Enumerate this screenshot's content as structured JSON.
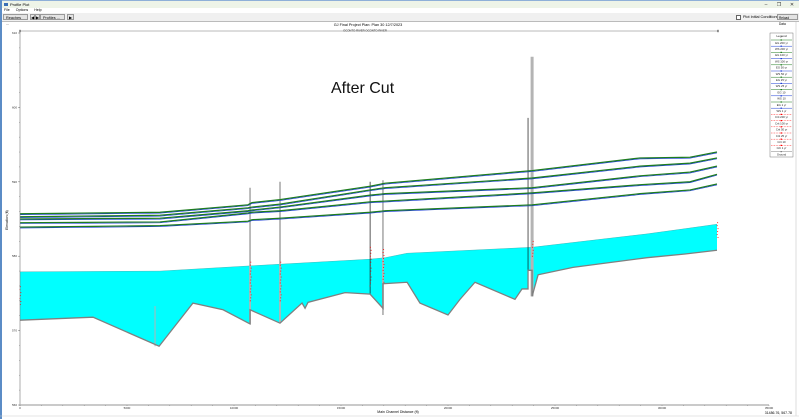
{
  "window": {
    "title": "Profile Plot",
    "minimize": "–",
    "maximize": "❐",
    "close": "✕"
  },
  "menu": [
    "File",
    "Options",
    "Help"
  ],
  "toolbar": {
    "reaches_label": "Reaches ...",
    "prev_label": "◀",
    "next_label": "▶",
    "profiles_label": "Profiles ...",
    "play_label": "▶",
    "plot_initial_label": "Plot Initial Conditions",
    "plot_initial_checked": false,
    "reload_label": "Reload Data"
  },
  "annotation": "After Cut",
  "status": {
    "coordinates": "31486.76, 567.78"
  },
  "colors": {
    "eg": "#1e7d1e",
    "ws": "#1a3cd6",
    "crit": "#ff0000",
    "ground": "#808080",
    "water_fill": "#00ffff",
    "structure": "#b4b4b4"
  },
  "chart_data": {
    "type": "line",
    "title": "GJ Final Project    Plan: Plan 30    12/7/2023",
    "subtitle": "OCONTO RIVER OCONTO RIVER",
    "xlabel": "Main Channel Distance (ft)",
    "ylabel": "Elevation (ft)",
    "xlim": [
      0,
      35000
    ],
    "ylim": [
      560,
      610
    ],
    "xticks": [
      0,
      5000,
      10000,
      15000,
      20000,
      25000,
      30000,
      35000
    ],
    "yticks": [
      560,
      570,
      580,
      590,
      600,
      610
    ],
    "legend": {
      "placement": "right",
      "title": "Legend",
      "entries": [
        "EG 200 yr",
        "WS 200 yr",
        "EG 100 yr",
        "WS 100 yr",
        "EG 50 yr",
        "WS 50 yr",
        "EG 25 yr",
        "WS 25 yr",
        "EG 10",
        "WS 10",
        "EG 1 yr",
        "WS 1 yr",
        "Crit 200 yr",
        "Crit 100 yr",
        "Crit 50 yr",
        "Crit 25 yr",
        "Crit 10",
        "Crit 1 yr",
        "Ground"
      ]
    },
    "profile_stations": [
      0,
      6540,
      10650,
      10840,
      12150,
      16360,
      17060,
      23930,
      28970,
      31310,
      32570
    ],
    "water_surface_lines": [
      [
        585.7,
        585.9,
        586.9,
        587.2,
        587.6,
        589.4,
        589.8,
        591.5,
        593.2,
        593.3,
        594.0
      ],
      [
        585.3,
        585.5,
        586.5,
        586.6,
        587.0,
        588.9,
        589.2,
        590.5,
        592.1,
        592.5,
        593.2
      ],
      [
        585.0,
        585.1,
        586.1,
        586.2,
        586.6,
        588.2,
        588.4,
        589.2,
        590.8,
        591.3,
        592.1
      ],
      [
        584.5,
        584.6,
        585.8,
        585.9,
        586.1,
        587.3,
        587.4,
        588.5,
        589.6,
        590.0,
        591.0
      ],
      [
        583.9,
        584.1,
        584.7,
        584.9,
        585.1,
        585.9,
        586.1,
        586.9,
        588.4,
        588.9,
        589.7
      ]
    ],
    "water_fill_top": {
      "x": [
        0,
        6540,
        10750,
        16360,
        17060,
        18090,
        23930,
        29300,
        31080,
        32570
      ],
      "y": [
        577.9,
        578.0,
        578.7,
        579.6,
        579.8,
        580.4,
        581.2,
        583.0,
        583.7,
        584.3
      ]
    },
    "ground": {
      "x": [
        0,
        3410,
        6500,
        8080,
        9490,
        10750,
        10750,
        12150,
        13180,
        13320,
        13460,
        15190,
        16360,
        16960,
        16960,
        18090,
        18690,
        20000,
        20560,
        21260,
        23130,
        23460,
        23740,
        23740,
        23930,
        23930,
        24210,
        25840,
        29300,
        31080,
        32570
      ],
      "y": [
        571.4,
        571.8,
        567.9,
        573.7,
        572.8,
        570.9,
        572.8,
        571.0,
        573.7,
        573.0,
        573.8,
        575.1,
        574.9,
        573.0,
        576.3,
        576.5,
        573.7,
        572.1,
        574.2,
        576.5,
        574.2,
        575.6,
        575.6,
        578.1,
        578.1,
        574.6,
        577.5,
        578.5,
        579.8,
        580.3,
        580.8
      ]
    },
    "structures": [
      {
        "station": 6310,
        "top": 573.3,
        "bottom": 567.9,
        "kind": "thin"
      },
      {
        "station": 10750,
        "top": 589.2,
        "bottom": 570.9,
        "kind": "bridge"
      },
      {
        "station": 12150,
        "top": 590.0,
        "bottom": 571.0,
        "kind": "bridge"
      },
      {
        "station": 16360,
        "top": 590.0,
        "bottom": 574.9,
        "kind": "line"
      },
      {
        "station": 16960,
        "top": 590.2,
        "bottom": 572.1,
        "kind": "bridge"
      },
      {
        "station": 23740,
        "top": 598.6,
        "bottom": 578.1,
        "kind": "line"
      },
      {
        "station": 23930,
        "top": 606.8,
        "bottom": 574.6,
        "kind": "wide"
      }
    ],
    "crit_markers": [
      {
        "station": 0,
        "elev_min": 573.5,
        "elev_max": 576.0
      },
      {
        "station": 10750,
        "elev_min": 574.0,
        "elev_max": 579.5
      },
      {
        "station": 12150,
        "elev_min": 574.0,
        "elev_max": 579.5
      },
      {
        "station": 16360,
        "elev_min": 576.0,
        "elev_max": 581.5
      },
      {
        "station": 16960,
        "elev_min": 576.5,
        "elev_max": 581.0
      },
      {
        "station": 23930,
        "elev_min": 580.0,
        "elev_max": 582.0
      },
      {
        "station": 32570,
        "elev_min": 582.5,
        "elev_max": 584.8
      }
    ]
  }
}
